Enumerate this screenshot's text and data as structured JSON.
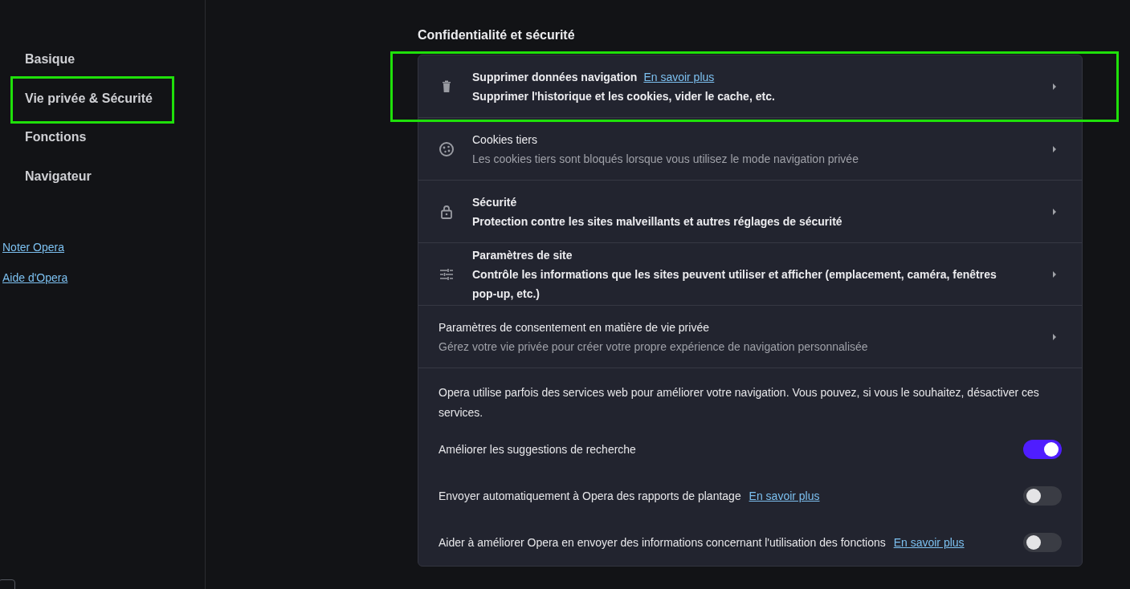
{
  "sidebar": {
    "items": [
      {
        "label": "Basique",
        "highlighted": false
      },
      {
        "label": "Vie privée & Sécurité",
        "highlighted": true
      },
      {
        "label": "Fonctions",
        "highlighted": false
      },
      {
        "label": "Navigateur",
        "highlighted": false
      }
    ],
    "links": [
      "Noter Opera",
      "Aide d'Opera"
    ]
  },
  "section": {
    "title": "Confidentialité et sécurité",
    "rows": [
      {
        "kind": "trash",
        "title": "Supprimer données navigation",
        "link": "En savoir plus",
        "description": "Supprimer l'historique et les cookies, vider le cache, etc.",
        "description_bold": true,
        "highlighted": true
      },
      {
        "kind": "cookie",
        "title": "Cookies tiers",
        "description": "Les cookies tiers sont bloqués lorsque vous utilisez le mode navigation privée",
        "description_bold": false,
        "highlighted": false
      },
      {
        "kind": "lock",
        "title": "Sécurité",
        "description": "Protection contre les sites malveillants et autres réglages de sécurité",
        "description_bold": true,
        "highlighted": false
      },
      {
        "kind": "sliders",
        "title": "Paramètres de site",
        "description": "Contrôle les informations que les sites peuvent utiliser et afficher (emplacement, caméra, fenêtres pop-up, etc.)",
        "description_bold": true,
        "highlighted": false
      },
      {
        "kind": "plain",
        "title": "Paramètres de consentement en matière de vie privée",
        "description": "Gérez votre vie privée pour créer votre propre expérience de navigation personnalisée",
        "description_bold": false,
        "highlighted": false
      }
    ],
    "intro": "Opera utilise parfois des services web pour améliorer votre navigation. Vous pouvez, si vous le souhaitez, désactiver ces services.",
    "toggles": [
      {
        "label": "Améliorer les suggestions de recherche",
        "on": true
      },
      {
        "label": "Envoyer automatiquement à Opera des rapports de plantage",
        "link": "En savoir plus",
        "on": false
      },
      {
        "label": "Aider à améliorer Opera en envoyer des informations concernant l'utilisation des fonctions",
        "link": "En savoir plus",
        "on": false
      }
    ]
  }
}
